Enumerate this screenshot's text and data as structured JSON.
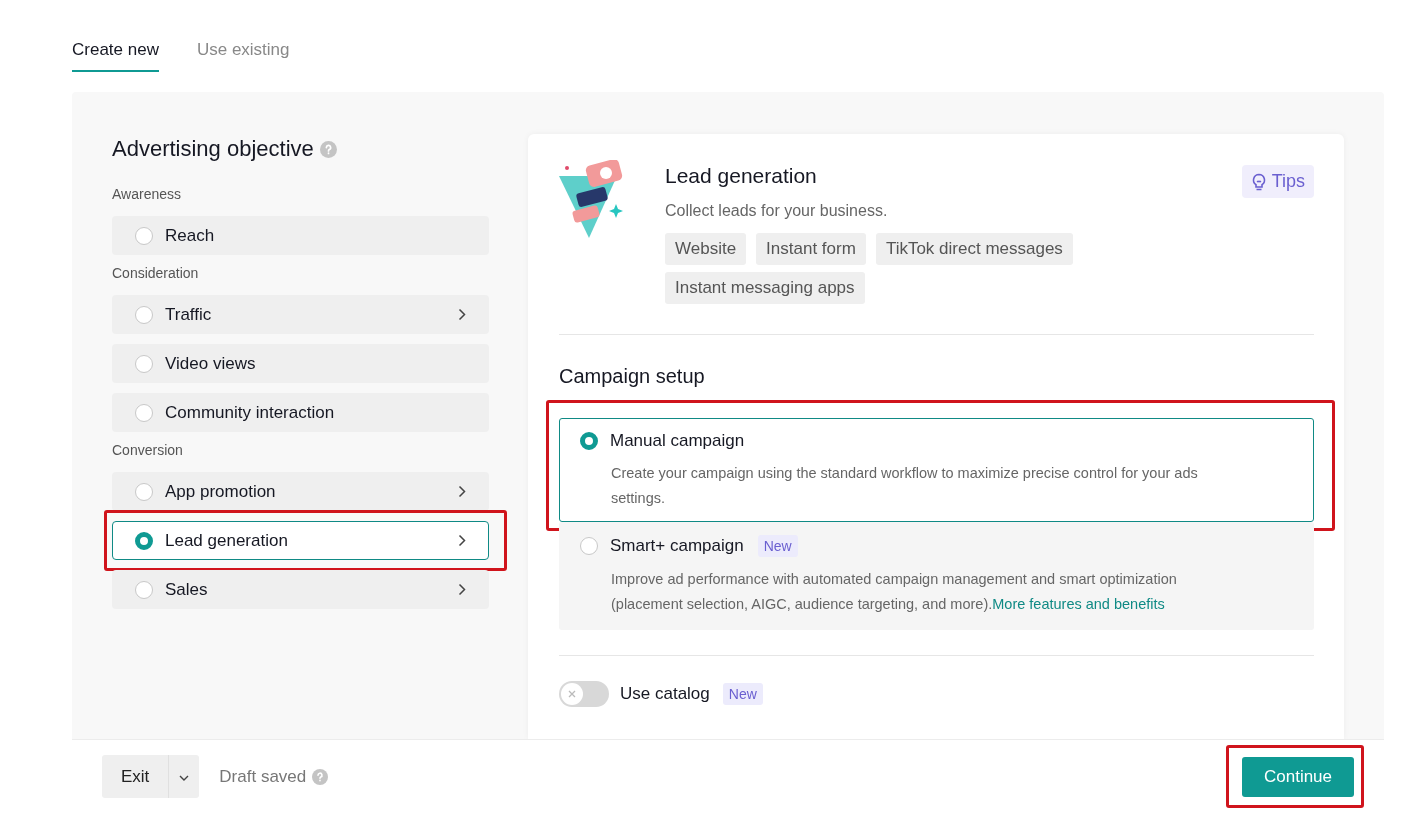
{
  "tabs": [
    {
      "label": "Create new",
      "selected": true
    },
    {
      "label": "Use existing",
      "selected": false
    }
  ],
  "objective": {
    "title": "Advertising objective",
    "groups": [
      {
        "label": "Awareness",
        "items": [
          {
            "label": "Reach",
            "selected": false,
            "submenu": false,
            "highlighted": false
          }
        ]
      },
      {
        "label": "Consideration",
        "items": [
          {
            "label": "Traffic",
            "selected": false,
            "submenu": true,
            "highlighted": false
          },
          {
            "label": "Video views",
            "selected": false,
            "submenu": false,
            "highlighted": false
          },
          {
            "label": "Community interaction",
            "selected": false,
            "submenu": false,
            "highlighted": false
          }
        ]
      },
      {
        "label": "Conversion",
        "items": [
          {
            "label": "App promotion",
            "selected": false,
            "submenu": true,
            "highlighted": false
          },
          {
            "label": "Lead generation",
            "selected": true,
            "submenu": true,
            "highlighted": true
          },
          {
            "label": "Sales",
            "selected": false,
            "submenu": true,
            "highlighted": false
          }
        ]
      }
    ]
  },
  "detail": {
    "title": "Lead generation",
    "subtitle": "Collect leads for your business.",
    "tips": "Tips",
    "tags": [
      "Website",
      "Instant form",
      "TikTok direct messages",
      "Instant messaging apps"
    ],
    "setup_title": "Campaign setup",
    "options": [
      {
        "title": "Manual campaign",
        "selected": true,
        "highlighted": true,
        "description": "Create your campaign using the standard workflow to maximize precise control for your ads settings."
      },
      {
        "title": "Smart+ campaign",
        "badge": "New",
        "selected": false,
        "highlighted": false,
        "description": "Improve ad performance with automated campaign management and smart optimization (placement selection, AIGC, audience targeting, and more).",
        "link": "More features and benefits"
      }
    ],
    "catalog": {
      "label": "Use catalog",
      "badge": "New",
      "on": false
    }
  },
  "footer": {
    "exit": "Exit",
    "draft": "Draft saved",
    "continue": {
      "label": "Continue",
      "highlighted": true
    }
  }
}
